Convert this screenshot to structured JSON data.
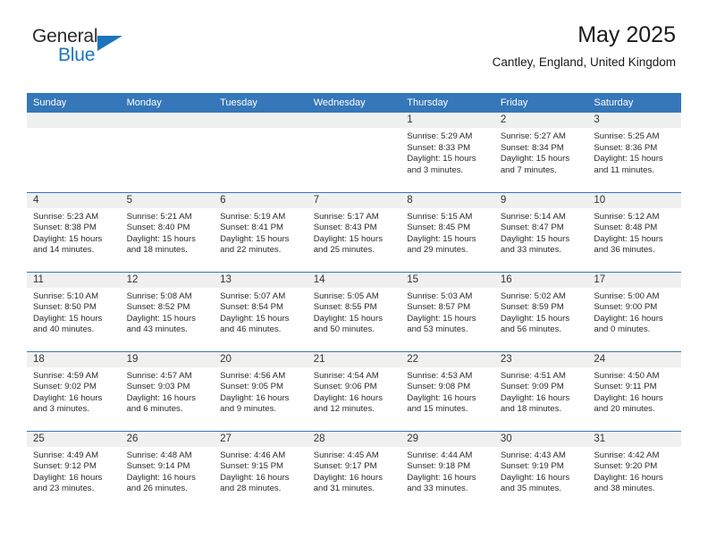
{
  "brand": {
    "name_part1": "General",
    "name_part2": "Blue",
    "triangle_icon": "triangle-icon"
  },
  "header": {
    "title": "May 2025",
    "subtitle": "Cantley, England, United Kingdom"
  },
  "colors": {
    "header_blue": "#3577b8",
    "brand_blue": "#1b75bb",
    "daynum_bg": "#f0f0f0",
    "text": "#2b2b2b"
  },
  "weekday_headers": [
    "Sunday",
    "Monday",
    "Tuesday",
    "Wednesday",
    "Thursday",
    "Friday",
    "Saturday"
  ],
  "weeks": [
    [
      {
        "day": "",
        "lines": []
      },
      {
        "day": "",
        "lines": []
      },
      {
        "day": "",
        "lines": []
      },
      {
        "day": "",
        "lines": []
      },
      {
        "day": "1",
        "lines": [
          "Sunrise: 5:29 AM",
          "Sunset: 8:33 PM",
          "Daylight: 15 hours",
          "and 3 minutes."
        ]
      },
      {
        "day": "2",
        "lines": [
          "Sunrise: 5:27 AM",
          "Sunset: 8:34 PM",
          "Daylight: 15 hours",
          "and 7 minutes."
        ]
      },
      {
        "day": "3",
        "lines": [
          "Sunrise: 5:25 AM",
          "Sunset: 8:36 PM",
          "Daylight: 15 hours",
          "and 11 minutes."
        ]
      }
    ],
    [
      {
        "day": "4",
        "lines": [
          "Sunrise: 5:23 AM",
          "Sunset: 8:38 PM",
          "Daylight: 15 hours",
          "and 14 minutes."
        ]
      },
      {
        "day": "5",
        "lines": [
          "Sunrise: 5:21 AM",
          "Sunset: 8:40 PM",
          "Daylight: 15 hours",
          "and 18 minutes."
        ]
      },
      {
        "day": "6",
        "lines": [
          "Sunrise: 5:19 AM",
          "Sunset: 8:41 PM",
          "Daylight: 15 hours",
          "and 22 minutes."
        ]
      },
      {
        "day": "7",
        "lines": [
          "Sunrise: 5:17 AM",
          "Sunset: 8:43 PM",
          "Daylight: 15 hours",
          "and 25 minutes."
        ]
      },
      {
        "day": "8",
        "lines": [
          "Sunrise: 5:15 AM",
          "Sunset: 8:45 PM",
          "Daylight: 15 hours",
          "and 29 minutes."
        ]
      },
      {
        "day": "9",
        "lines": [
          "Sunrise: 5:14 AM",
          "Sunset: 8:47 PM",
          "Daylight: 15 hours",
          "and 33 minutes."
        ]
      },
      {
        "day": "10",
        "lines": [
          "Sunrise: 5:12 AM",
          "Sunset: 8:48 PM",
          "Daylight: 15 hours",
          "and 36 minutes."
        ]
      }
    ],
    [
      {
        "day": "11",
        "lines": [
          "Sunrise: 5:10 AM",
          "Sunset: 8:50 PM",
          "Daylight: 15 hours",
          "and 40 minutes."
        ]
      },
      {
        "day": "12",
        "lines": [
          "Sunrise: 5:08 AM",
          "Sunset: 8:52 PM",
          "Daylight: 15 hours",
          "and 43 minutes."
        ]
      },
      {
        "day": "13",
        "lines": [
          "Sunrise: 5:07 AM",
          "Sunset: 8:54 PM",
          "Daylight: 15 hours",
          "and 46 minutes."
        ]
      },
      {
        "day": "14",
        "lines": [
          "Sunrise: 5:05 AM",
          "Sunset: 8:55 PM",
          "Daylight: 15 hours",
          "and 50 minutes."
        ]
      },
      {
        "day": "15",
        "lines": [
          "Sunrise: 5:03 AM",
          "Sunset: 8:57 PM",
          "Daylight: 15 hours",
          "and 53 minutes."
        ]
      },
      {
        "day": "16",
        "lines": [
          "Sunrise: 5:02 AM",
          "Sunset: 8:59 PM",
          "Daylight: 15 hours",
          "and 56 minutes."
        ]
      },
      {
        "day": "17",
        "lines": [
          "Sunrise: 5:00 AM",
          "Sunset: 9:00 PM",
          "Daylight: 16 hours",
          "and 0 minutes."
        ]
      }
    ],
    [
      {
        "day": "18",
        "lines": [
          "Sunrise: 4:59 AM",
          "Sunset: 9:02 PM",
          "Daylight: 16 hours",
          "and 3 minutes."
        ]
      },
      {
        "day": "19",
        "lines": [
          "Sunrise: 4:57 AM",
          "Sunset: 9:03 PM",
          "Daylight: 16 hours",
          "and 6 minutes."
        ]
      },
      {
        "day": "20",
        "lines": [
          "Sunrise: 4:56 AM",
          "Sunset: 9:05 PM",
          "Daylight: 16 hours",
          "and 9 minutes."
        ]
      },
      {
        "day": "21",
        "lines": [
          "Sunrise: 4:54 AM",
          "Sunset: 9:06 PM",
          "Daylight: 16 hours",
          "and 12 minutes."
        ]
      },
      {
        "day": "22",
        "lines": [
          "Sunrise: 4:53 AM",
          "Sunset: 9:08 PM",
          "Daylight: 16 hours",
          "and 15 minutes."
        ]
      },
      {
        "day": "23",
        "lines": [
          "Sunrise: 4:51 AM",
          "Sunset: 9:09 PM",
          "Daylight: 16 hours",
          "and 18 minutes."
        ]
      },
      {
        "day": "24",
        "lines": [
          "Sunrise: 4:50 AM",
          "Sunset: 9:11 PM",
          "Daylight: 16 hours",
          "and 20 minutes."
        ]
      }
    ],
    [
      {
        "day": "25",
        "lines": [
          "Sunrise: 4:49 AM",
          "Sunset: 9:12 PM",
          "Daylight: 16 hours",
          "and 23 minutes."
        ]
      },
      {
        "day": "26",
        "lines": [
          "Sunrise: 4:48 AM",
          "Sunset: 9:14 PM",
          "Daylight: 16 hours",
          "and 26 minutes."
        ]
      },
      {
        "day": "27",
        "lines": [
          "Sunrise: 4:46 AM",
          "Sunset: 9:15 PM",
          "Daylight: 16 hours",
          "and 28 minutes."
        ]
      },
      {
        "day": "28",
        "lines": [
          "Sunrise: 4:45 AM",
          "Sunset: 9:17 PM",
          "Daylight: 16 hours",
          "and 31 minutes."
        ]
      },
      {
        "day": "29",
        "lines": [
          "Sunrise: 4:44 AM",
          "Sunset: 9:18 PM",
          "Daylight: 16 hours",
          "and 33 minutes."
        ]
      },
      {
        "day": "30",
        "lines": [
          "Sunrise: 4:43 AM",
          "Sunset: 9:19 PM",
          "Daylight: 16 hours",
          "and 35 minutes."
        ]
      },
      {
        "day": "31",
        "lines": [
          "Sunrise: 4:42 AM",
          "Sunset: 9:20 PM",
          "Daylight: 16 hours",
          "and 38 minutes."
        ]
      }
    ]
  ]
}
